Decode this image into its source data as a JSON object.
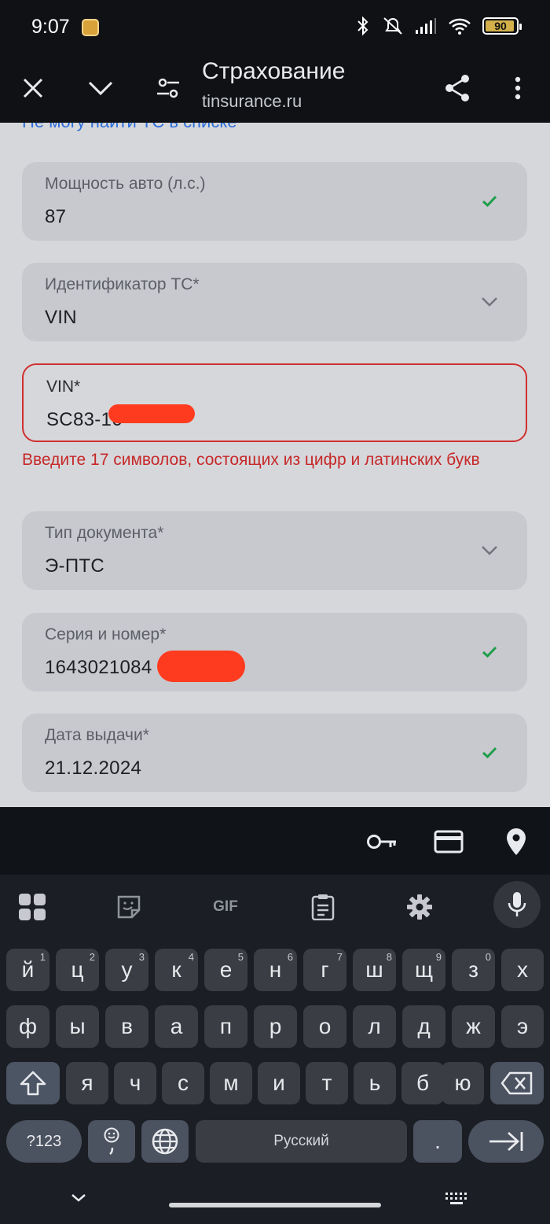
{
  "status_bar": {
    "time": "9:07",
    "battery": "90",
    "icons": [
      "bluetooth-icon",
      "muted-icon",
      "signal-icon",
      "wifi-icon",
      "battery-icon"
    ]
  },
  "browser": {
    "title": "Страхование",
    "url": "tinsurance.ru"
  },
  "form": {
    "top_link": "Не могу найти ТС в списке",
    "fields": [
      {
        "label": "Мощность авто (л.с.)",
        "value": "87",
        "status": "valid"
      },
      {
        "label": "Идентификатор ТС*",
        "value": "VIN",
        "status": "dropdown"
      },
      {
        "label": "VIN*",
        "value": "SC83-16",
        "status": "error"
      },
      {
        "label": "Тип документа*",
        "value": "Э-ПТС",
        "status": "dropdown"
      },
      {
        "label": "Серия и номер*",
        "value": "1643021084",
        "status": "valid"
      },
      {
        "label": "Дата выдачи*",
        "value": "21.12.2024",
        "status": "valid"
      }
    ],
    "error_message": "Введите 17 символов, состоящих из цифр и латинских букв"
  },
  "keyboard": {
    "row1": [
      {
        "k": "й",
        "n": "1"
      },
      {
        "k": "ц",
        "n": "2"
      },
      {
        "k": "у",
        "n": "3"
      },
      {
        "k": "к",
        "n": "4"
      },
      {
        "k": "е",
        "n": "5"
      },
      {
        "k": "н",
        "n": "6"
      },
      {
        "k": "г",
        "n": "7"
      },
      {
        "k": "ш",
        "n": "8"
      },
      {
        "k": "щ",
        "n": "9"
      },
      {
        "k": "з",
        "n": "0"
      },
      {
        "k": "х",
        "n": ""
      }
    ],
    "row2": [
      "ф",
      "ы",
      "в",
      "а",
      "п",
      "р",
      "о",
      "л",
      "д",
      "ж",
      "э"
    ],
    "row3": [
      "я",
      "ч",
      "с",
      "м",
      "и",
      "т",
      "ь",
      "б",
      "ю"
    ],
    "symbols_label": "?123",
    "space_label": "Русский",
    "period_label": ".",
    "gif_label": "GIF"
  },
  "colors": {
    "error": "#c62828",
    "valid_check": "#1e9e4a",
    "link": "#2f6fd8"
  }
}
